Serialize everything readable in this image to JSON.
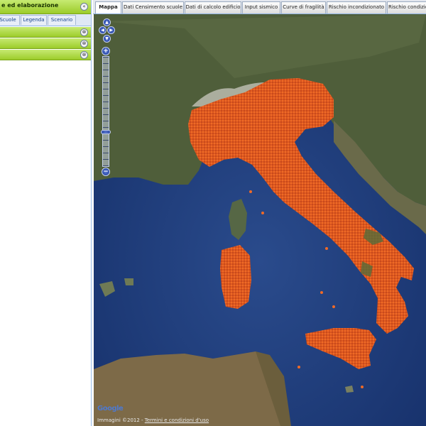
{
  "left_panel": {
    "title": "e ed elaborazione",
    "collapse_glyph": "«",
    "tabs": [
      {
        "label": "Scuole"
      },
      {
        "label": "Legenda"
      },
      {
        "label": "Scenario"
      }
    ],
    "accordion_glyph": "⊗"
  },
  "main_tabs": [
    {
      "label": "Mappa"
    },
    {
      "label": "Dati Censimento scuole"
    },
    {
      "label": "Dati di calcolo edificio"
    },
    {
      "label": "Input sismico"
    },
    {
      "label": "Curve di fragilità"
    },
    {
      "label": "Rischio incondizionato"
    },
    {
      "label": "Rischio condizio"
    }
  ],
  "map": {
    "google_logo": "Google",
    "copyright": "Immagini ©2012 - ",
    "terms_link": "Termini e condizioni d'uso",
    "marker_color": "#e8541a",
    "sea_color": "#1e3a78",
    "controls": {
      "pan_up": "▲",
      "pan_left": "◀",
      "pan_right": "▶",
      "pan_down": "▼",
      "zoom_in": "+",
      "zoom_out": "−"
    }
  },
  "colors": {
    "panel_header": "#9ccc2a",
    "tab_border": "#8db2e3"
  }
}
